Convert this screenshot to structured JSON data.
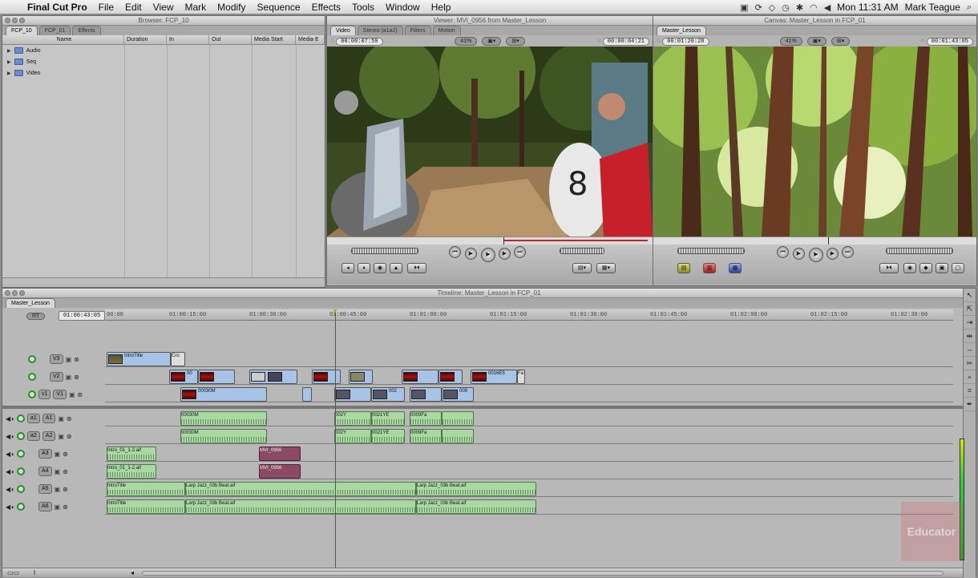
{
  "menubar": {
    "app_name": "Final Cut Pro",
    "items": [
      "File",
      "Edit",
      "View",
      "Mark",
      "Modify",
      "Sequence",
      "Effects",
      "Tools",
      "Window",
      "Help"
    ],
    "clock": "Mon 11:31 AM",
    "user": "Mark Teague"
  },
  "browser": {
    "title": "Browser: FCP_10",
    "tabs": [
      "FCP_10",
      "FCP_01",
      "Effects"
    ],
    "columns": [
      "Name",
      "Duration",
      "In",
      "Out",
      "Media Start",
      "Media E"
    ],
    "items": [
      "Audio",
      "Seq",
      "Video"
    ]
  },
  "viewer": {
    "title": "Viewer: MVI_0956 from Master_Lesson",
    "tabs": [
      "Video",
      "Stereo (a1a2)",
      "Filters",
      "Motion"
    ],
    "duration_tc": "00:00:07:59",
    "zoom": "41%",
    "current_tc": "00:00:04:21"
  },
  "canvas": {
    "title": "Canvas: Master_Lesson in FCP_01",
    "tab": "Master_Lesson",
    "duration_tc": "00:01:20:28",
    "zoom": "41%",
    "current_tc": "00:01:43:05"
  },
  "timeline": {
    "title": "Timeline: Master_Lesson in FCP_01",
    "tab": "Master_Lesson",
    "rt_label": "RT",
    "current_tc": "01:00:43:05",
    "ruler_ticks": [
      "00:00",
      "01:00:15:00",
      "01:00:30:00",
      "01:00:45:00",
      "01:01:00:00",
      "01:01:15:00",
      "01:01:30:00",
      "01:01:45:00",
      "01:02:00:00",
      "01:02:15:00",
      "01:02:30:00"
    ],
    "video_tracks": [
      {
        "label": "V3",
        "clips": [
          "IntroTitle",
          "Cro"
        ]
      },
      {
        "label": "V2",
        "clips": [
          "00",
          "0016E5",
          "Fa"
        ]
      },
      {
        "label": "V1",
        "src": "v1",
        "clips": [
          "00030M",
          "002",
          "009"
        ]
      }
    ],
    "audio_tracks": [
      {
        "label": "A1",
        "src": "a1",
        "clips": [
          "00030M",
          "0009Fa",
          "002Y",
          "0021YE"
        ]
      },
      {
        "label": "A2",
        "src": "a2",
        "clips": [
          "00030M",
          "0009Fa",
          "002Y",
          "0021YE"
        ]
      },
      {
        "label": "A3",
        "clips": [
          "Intro_01_1-2.aif",
          "MVI_0956"
        ]
      },
      {
        "label": "A4",
        "clips": [
          "Intro_01_1-2.aif",
          "MVI_0956"
        ]
      },
      {
        "label": "A5",
        "clips": [
          "IntroTitle",
          "Larp Jazz_03b Beat.aif",
          "Larp Jazz_03b Beat.aif"
        ]
      },
      {
        "label": "A6",
        "clips": [
          "IntroTitle",
          "Larp Jazz_03b Beat.aif",
          "Larp Jazz_03b Beat.aif"
        ]
      }
    ]
  },
  "watermark": "Educator",
  "colors": {
    "video_clip": "#a7c3e6",
    "audio_clip": "#a9d8a3",
    "purple_clip": "#8a4a64"
  }
}
